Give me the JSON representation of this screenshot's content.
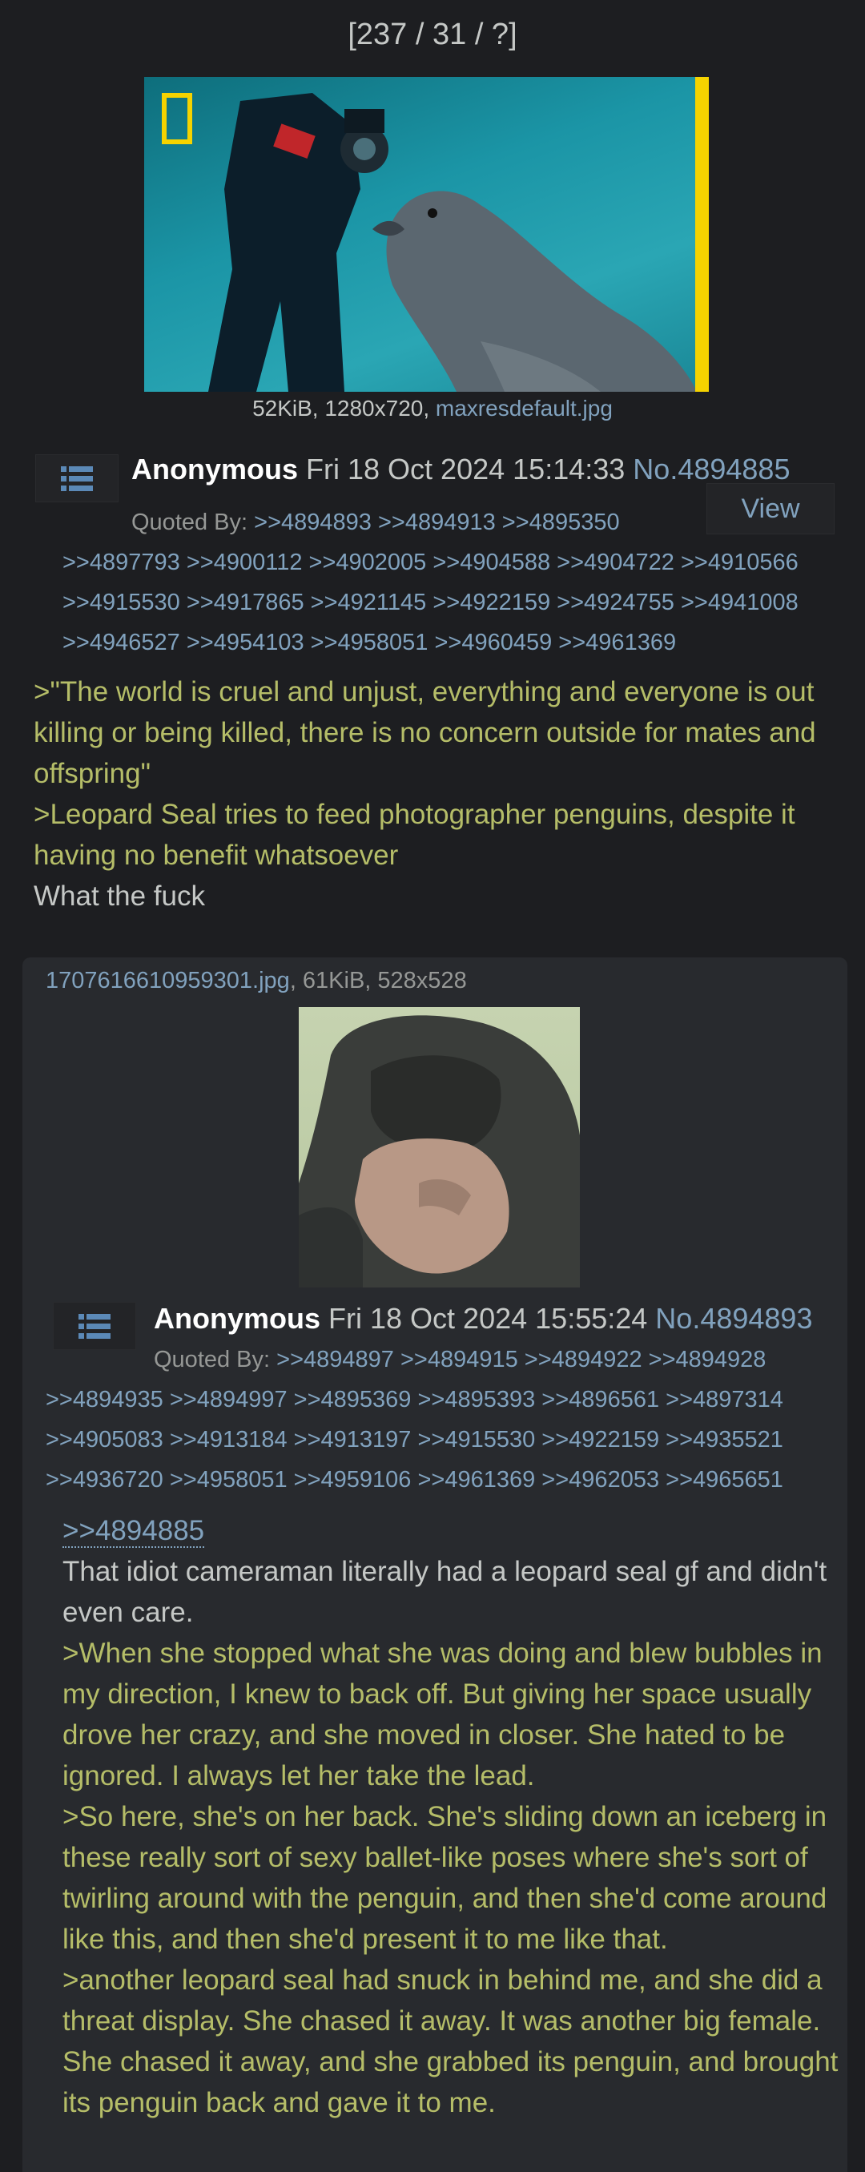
{
  "counter": "[237 / 31 / ?]",
  "op": {
    "file_info_prefix": "52KiB, 1280x720, ",
    "file_name": "maxresdefault.jpg",
    "name": "Anonymous",
    "date": "Fri 18 Oct 2024 15:14:33",
    "number": "No.4894885",
    "view_label": "View",
    "quoted_by_label": "Quoted By:",
    "quoted_by_lines": [
      ">>4894893 >>4894913 >>4895350",
      ">>4897793 >>4900112 >>4902005 >>4904588 >>4904722 >>4910566",
      ">>4915530 >>4917865 >>4921145 >>4922159 >>4924755 >>4941008",
      ">>4946527 >>4954103 >>4958051 >>4960459 >>4961369"
    ],
    "body": [
      {
        "type": "greentext",
        "text": ">\"The world is cruel and unjust, everything and everyone is out killing or being killed, there is no concern outside for mates and offspring\""
      },
      {
        "type": "greentext",
        "text": ">Leopard Seal tries to feed photographer penguins, despite it having no benefit whatsoever"
      },
      {
        "type": "plain",
        "text": "What the fuck"
      }
    ]
  },
  "reply": {
    "file_name": "1707616610959301.jpg",
    "file_info_suffix": ", 61KiB, 528x528",
    "name": "Anonymous",
    "date": "Fri 18 Oct 2024 15:55:24",
    "number": "No.4894893",
    "quoted_by_label": "Quoted By:",
    "quoted_by_lines": [
      ">>4894897 >>4894915 >>4894922 >>4894928",
      ">>4894935 >>4894997 >>4895369 >>4895393 >>4896561 >>4897314",
      ">>4905083 >>4913184 >>4913197 >>4915530 >>4922159 >>4935521",
      ">>4936720 >>4958051 >>4959106 >>4961369 >>4962053 >>4965651"
    ],
    "quotelink": ">>4894885",
    "body": [
      {
        "type": "plain",
        "text": "That idiot cameraman literally had a leopard seal gf and didn't even care."
      },
      {
        "type": "greentext",
        "text": ">When she stopped what she was doing and blew bubbles in my direction, I knew to back off. But giving her space usually drove her crazy, and she moved in closer. She hated to be ignored. I always let her take the lead."
      },
      {
        "type": "greentext",
        "text": ">So here, she's on her back. She's sliding down an iceberg in these really sort of sexy ballet-like poses where she's sort of twirling around with the penguin, and then she'd come around like this, and then she'd present it to me like that."
      },
      {
        "type": "greentext",
        "text": ">another leopard seal had snuck in behind me, and she did a threat display. She chased it away. It was another big female. She chased it away, and she grabbed its penguin, and brought its penguin back and gave it to me."
      }
    ]
  },
  "icons": {
    "menu": "list-menu-icon"
  },
  "colors": {
    "background": "#1d1e21",
    "reply_background": "#282a2e",
    "link": "#81a2be",
    "greentext": "#b5bd68",
    "text": "#c5c8c6"
  }
}
